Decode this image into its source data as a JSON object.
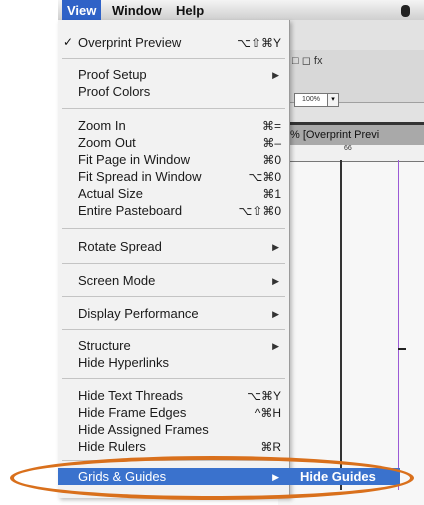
{
  "menubar": {
    "items": [
      {
        "label": "View"
      },
      {
        "label": "Window"
      },
      {
        "label": "Help"
      }
    ]
  },
  "app": {
    "toolbar_icons": "□ ◻ fx",
    "zoom": "100%",
    "doc_tab": "% [Overprint Previ",
    "ruler_num": "66"
  },
  "view_menu": {
    "groups": [
      [
        {
          "label": "Overprint Preview",
          "shortcut": "⌥⇧⌘Y",
          "checked": true
        }
      ],
      [
        {
          "label": "Proof Setup",
          "submenu": true
        },
        {
          "label": "Proof Colors"
        }
      ],
      [
        {
          "label": "Zoom In",
          "shortcut": "⌘="
        },
        {
          "label": "Zoom Out",
          "shortcut": "⌘–"
        },
        {
          "label": "Fit Page in Window",
          "shortcut": "⌘0"
        },
        {
          "label": "Fit Spread in Window",
          "shortcut": "⌥⌘0"
        },
        {
          "label": "Actual Size",
          "shortcut": "⌘1"
        },
        {
          "label": "Entire Pasteboard",
          "shortcut": "⌥⇧⌘0"
        }
      ],
      [
        {
          "label": "Rotate Spread",
          "submenu": true
        }
      ],
      [
        {
          "label": "Screen Mode",
          "submenu": true
        }
      ],
      [
        {
          "label": "Display Performance",
          "submenu": true
        }
      ],
      [
        {
          "label": "Structure",
          "submenu": true
        },
        {
          "label": "Hide Hyperlinks"
        }
      ],
      [
        {
          "label": "Hide Text Threads",
          "shortcut": "⌥⌘Y"
        },
        {
          "label": "Hide Frame Edges",
          "shortcut": "^⌘H"
        },
        {
          "label": "Hide Assigned Frames"
        },
        {
          "label": "Hide Rulers",
          "shortcut": "⌘R"
        }
      ]
    ],
    "selected": {
      "label": "Grids & Guides",
      "submenu": true
    }
  },
  "submenu": {
    "item": "Hide Guides"
  },
  "colors": {
    "highlight": "#3a72cd",
    "annotation_oval": "#d9701c"
  }
}
